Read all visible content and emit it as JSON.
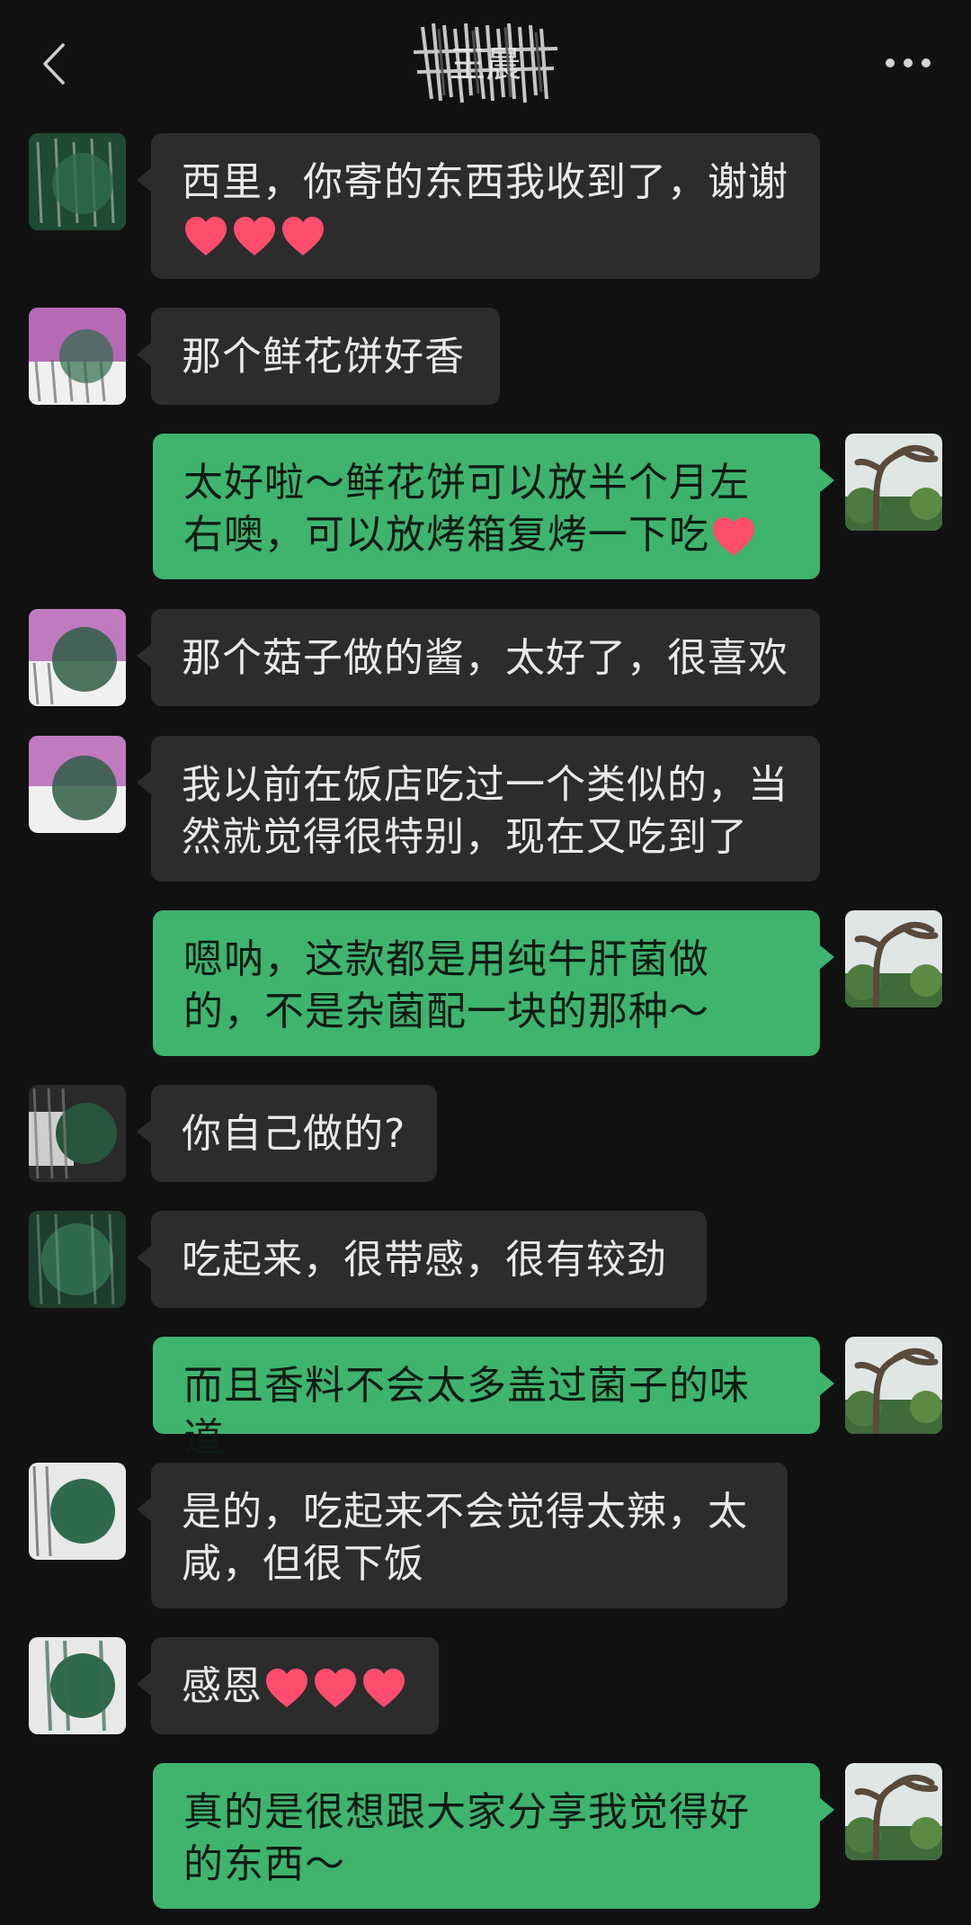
{
  "header": {
    "title": "王晨",
    "back_icon": "chevron-left-icon",
    "more_icon": "more-horizontal-icon"
  },
  "colors": {
    "background": "#111111",
    "incoming_bubble": "#2c2c2c",
    "outgoing_bubble": "#3eb46f",
    "heart": "#ff4d6d"
  },
  "messages": [
    {
      "side": "in",
      "text": "西里，你寄的东西我收到了，谢谢",
      "hearts": 3
    },
    {
      "side": "in",
      "text": "那个鲜花饼好香",
      "hearts": 0
    },
    {
      "side": "out",
      "text": "太好啦～鲜花饼可以放半个月左右噢，可以放烤箱复烤一下吃",
      "hearts": 1
    },
    {
      "side": "in",
      "text": "那个菇子做的酱，太好了，很喜欢",
      "hearts": 0
    },
    {
      "side": "in",
      "text": "我以前在饭店吃过一个类似的，当然就觉得很特别，现在又吃到了",
      "hearts": 0
    },
    {
      "side": "out",
      "text": "嗯呐，这款都是用纯牛肝菌做的，不是杂菌配一块的那种～",
      "hearts": 0
    },
    {
      "side": "in",
      "text": "你自己做的?",
      "hearts": 0
    },
    {
      "side": "in",
      "text": "吃起来，很带感，很有较劲",
      "hearts": 0
    },
    {
      "side": "out",
      "text": "而且香料不会太多盖过菌子的味道",
      "hearts": 0
    },
    {
      "side": "in",
      "text": "是的，吃起来不会觉得太辣，太咸，但很下饭",
      "hearts": 0
    },
    {
      "side": "in",
      "text": "感恩",
      "hearts": 3
    },
    {
      "side": "out",
      "text": "真的是很想跟大家分享我觉得好的东西～",
      "hearts": 0
    }
  ]
}
